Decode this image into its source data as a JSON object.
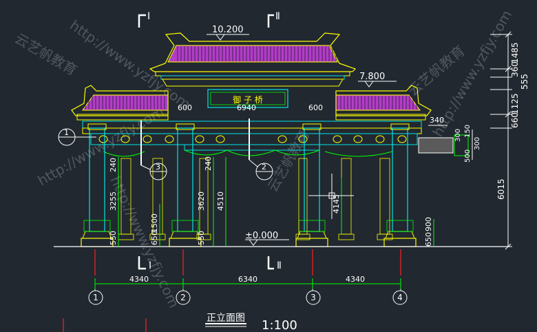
{
  "plaque_text": "御 子 桥",
  "elevations": {
    "top": "10.200",
    "side": "7.800",
    "ground": "±0.000"
  },
  "section_marks": {
    "top_left": "Ⅰ",
    "top_right": "Ⅱ",
    "bottom_left": "Ⅰ",
    "bottom_right": "Ⅱ"
  },
  "dims_bottom": [
    "4340",
    "6340",
    "4340"
  ],
  "dims_top": {
    "left": "600",
    "center": "6940",
    "right": "600"
  },
  "dims_right_vertical": [
    "1485",
    "360",
    "555",
    "1125",
    "660",
    "6015"
  ],
  "dims_side_detail": [
    "340",
    "300",
    "150",
    "300",
    "500"
  ],
  "dims_columns": {
    "left": [
      "240",
      "3255",
      "550"
    ],
    "left_inner": [
      "1500",
      "650"
    ],
    "center_left": [
      "240",
      "3620",
      "550"
    ],
    "center": [
      "4510"
    ],
    "center_right": [
      "4145"
    ],
    "right": [
      "900",
      "650"
    ]
  },
  "axis_labels": [
    "1",
    "2",
    "3",
    "4"
  ],
  "detail_callouts": [
    "1",
    "3",
    "2"
  ],
  "title": "正立面图",
  "scale": "1:100",
  "watermark": {
    "url": "http://www.yzfjy.com",
    "brand": "云艺帆教育"
  },
  "colors": {
    "background": "#212830",
    "roof": "#b43cc8",
    "column": "#00e6e6",
    "outline": "#ffff00",
    "dimension": "#00ff00",
    "text": "#ffffff",
    "axis": "#ff2020"
  }
}
